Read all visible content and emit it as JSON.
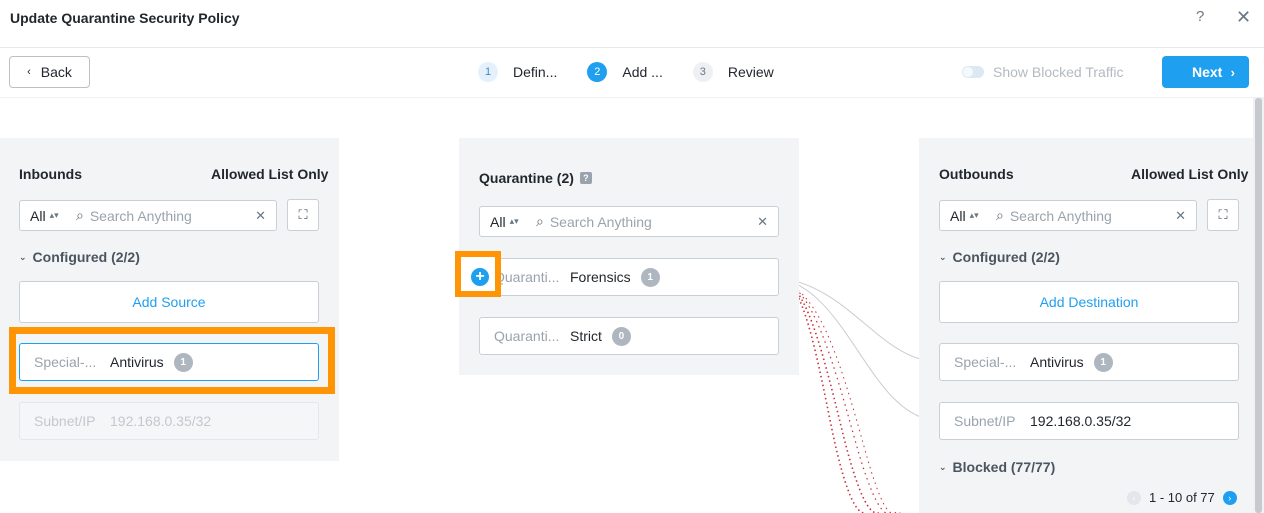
{
  "header": {
    "title": "Update Quarantine Security Policy",
    "help": "?",
    "close": "✕"
  },
  "toolbar": {
    "back_label": "Back",
    "steps": [
      {
        "num": "1",
        "label": "Defin..."
      },
      {
        "num": "2",
        "label": "Add ..."
      },
      {
        "num": "3",
        "label": "Review"
      }
    ],
    "toggle_label": "Show Blocked Traffic",
    "next_label": "Next"
  },
  "inbounds": {
    "title": "Inbounds",
    "mode": "Allowed List Only",
    "filter": "All",
    "search_placeholder": "Search Anything",
    "section": "Configured (2/2)",
    "add_label": "Add Source",
    "items": [
      {
        "kind": "Special-...",
        "name": "Antivirus",
        "count": "1"
      },
      {
        "kind": "Subnet/IP",
        "name": "192.168.0.35/32"
      }
    ]
  },
  "quarantine": {
    "title": "Quarantine (2)",
    "info": "?",
    "filter": "All",
    "search_placeholder": "Search Anything",
    "items": [
      {
        "kind": "Quaranti...",
        "name": "Forensics",
        "count": "1"
      },
      {
        "kind": "Quaranti...",
        "name": "Strict",
        "count": "0"
      }
    ]
  },
  "outbounds": {
    "title": "Outbounds",
    "mode": "Allowed List Only",
    "filter": "All",
    "search_placeholder": "Search Anything",
    "section": "Configured (2/2)",
    "add_label": "Add Destination",
    "items": [
      {
        "kind": "Special-...",
        "name": "Antivirus",
        "count": "1"
      },
      {
        "kind": "Subnet/IP",
        "name": "192.168.0.35/32"
      }
    ],
    "blocked_section": "Blocked (77/77)",
    "pager": "1 - 10 of 77"
  },
  "colors": {
    "accent": "#1f9ff0",
    "highlight": "#ff9505",
    "blocked_line": "#c8323c"
  }
}
